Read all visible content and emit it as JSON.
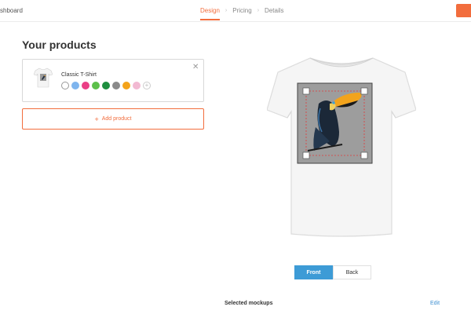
{
  "header": {
    "breadcrumb": "shboard",
    "steps": [
      {
        "label": "Design",
        "active": true
      },
      {
        "label": "Pricing",
        "active": false
      },
      {
        "label": "Details",
        "active": false
      }
    ],
    "step_separator": "›"
  },
  "products": {
    "title": "Your products",
    "items": [
      {
        "name": "Classic T-Shirt",
        "colors": [
          "#ffffff",
          "#7fb5ee",
          "#ea3f86",
          "#5cc04a",
          "#1e8f3f",
          "#8a8a8a",
          "#f3a31a",
          "#f2b9d2"
        ],
        "add_color_icon": "plus-circle-icon",
        "remove_icon": "close-icon"
      }
    ],
    "add_label": "Add product",
    "add_icon": "plus-icon"
  },
  "preview": {
    "front_label": "Front",
    "back_label": "Back",
    "active_view": "Front"
  },
  "footer": {
    "selected_mockups": "Selected mockups",
    "edit_label": "Edit"
  },
  "colors": {
    "accent": "#f26d3d",
    "primary": "#3d9bd6"
  }
}
